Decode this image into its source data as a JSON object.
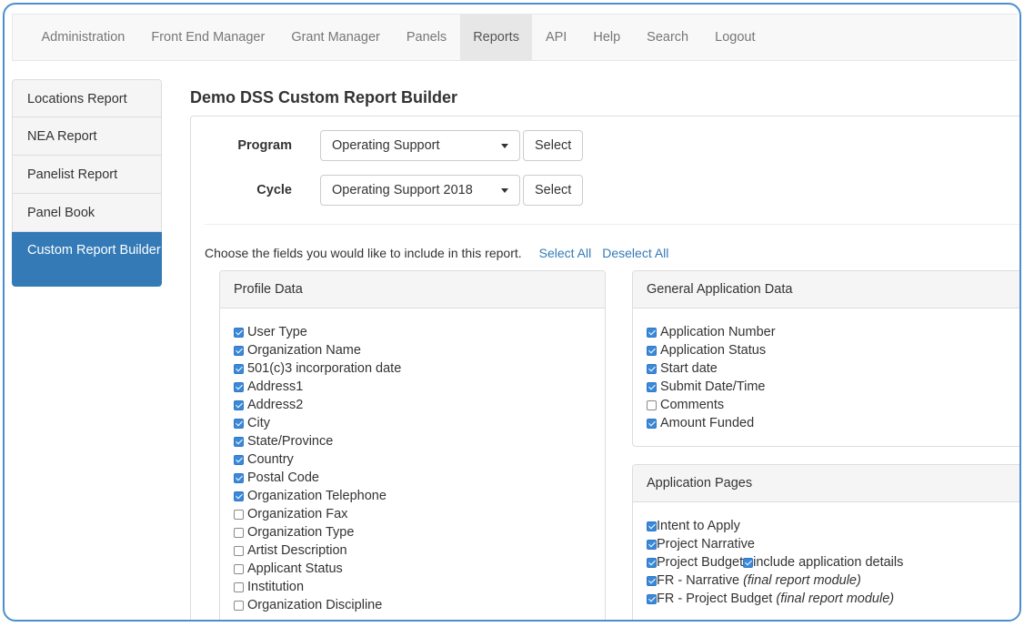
{
  "nav": {
    "items": [
      {
        "label": "Administration",
        "name": "nav-administration",
        "active": false
      },
      {
        "label": "Front End Manager",
        "name": "nav-front-end-manager",
        "active": false
      },
      {
        "label": "Grant Manager",
        "name": "nav-grant-manager",
        "active": false
      },
      {
        "label": "Panels",
        "name": "nav-panels",
        "active": false
      },
      {
        "label": "Reports",
        "name": "nav-reports",
        "active": true
      },
      {
        "label": "API",
        "name": "nav-api",
        "active": false
      },
      {
        "label": "Help",
        "name": "nav-help",
        "active": false
      },
      {
        "label": "Search",
        "name": "nav-search",
        "active": false
      },
      {
        "label": "Logout",
        "name": "nav-logout",
        "active": false
      }
    ]
  },
  "sidebar": {
    "items": [
      {
        "label": "Locations Report",
        "name": "sidebar-item-locations-report",
        "active": false
      },
      {
        "label": "NEA Report",
        "name": "sidebar-item-nea-report",
        "active": false
      },
      {
        "label": "Panelist Report",
        "name": "sidebar-item-panelist-report",
        "active": false
      },
      {
        "label": "Panel Book",
        "name": "sidebar-item-panel-book",
        "active": false
      },
      {
        "label": "Custom Report Builder",
        "name": "sidebar-item-custom-report-builder",
        "active": true
      }
    ]
  },
  "page": {
    "title": "Demo DSS Custom Report Builder"
  },
  "form": {
    "program": {
      "label": "Program",
      "value": "Operating Support",
      "button": "Select"
    },
    "cycle": {
      "label": "Cycle",
      "value": "Operating Support 2018",
      "button": "Select"
    }
  },
  "choose": {
    "text": "Choose the fields you would like to include in this report.",
    "select_all": "Select All",
    "deselect_all": "Deselect All"
  },
  "profile": {
    "title": "Profile Data",
    "fields": [
      {
        "label": "User Type",
        "checked": true
      },
      {
        "label": "Organization Name",
        "checked": true
      },
      {
        "label": "501(c)3 incorporation date",
        "checked": true
      },
      {
        "label": "Address1",
        "checked": true
      },
      {
        "label": "Address2",
        "checked": true
      },
      {
        "label": "City",
        "checked": true
      },
      {
        "label": "State/Province",
        "checked": true
      },
      {
        "label": "Country",
        "checked": true
      },
      {
        "label": "Postal Code",
        "checked": true
      },
      {
        "label": "Organization Telephone",
        "checked": true
      },
      {
        "label": "Organization Fax",
        "checked": false
      },
      {
        "label": "Organization Type",
        "checked": false
      },
      {
        "label": "Artist Description",
        "checked": false
      },
      {
        "label": "Applicant Status",
        "checked": false
      },
      {
        "label": "Institution",
        "checked": false
      },
      {
        "label": "Organization Discipline",
        "checked": false
      }
    ]
  },
  "general": {
    "title": "General Application Data",
    "fields": [
      {
        "label": "Application Number",
        "checked": true
      },
      {
        "label": "Application Status",
        "checked": true
      },
      {
        "label": "Start date",
        "checked": true
      },
      {
        "label": "Submit Date/Time",
        "checked": true
      },
      {
        "label": "Comments",
        "checked": false
      },
      {
        "label": "Amount Funded",
        "checked": true
      }
    ]
  },
  "pages": {
    "title": "Application Pages",
    "fields": [
      {
        "label": "Intent to Apply",
        "checked": true
      },
      {
        "label": "Project Narrative",
        "checked": true
      },
      {
        "label": "Project Budget",
        "checked": true,
        "extra_label": "include application details",
        "extra_checked": true
      },
      {
        "label": "FR - Narrative",
        "note": "(final report module)",
        "checked": true
      },
      {
        "label": "FR - Project Budget",
        "note": "(final report module)",
        "checked": true
      }
    ]
  }
}
